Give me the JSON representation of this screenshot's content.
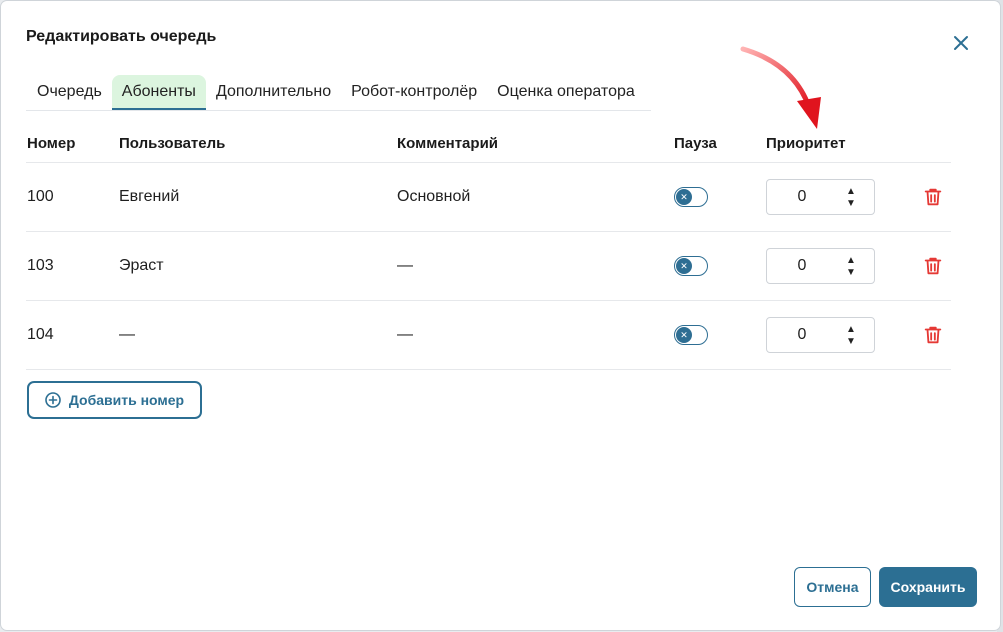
{
  "dialog": {
    "title": "Редактировать очередь",
    "close_icon": "close-icon"
  },
  "tabs": [
    {
      "label": "Очередь",
      "active": false
    },
    {
      "label": "Абоненты",
      "active": true
    },
    {
      "label": "Дополнительно",
      "active": false
    },
    {
      "label": "Робот-контролёр",
      "active": false
    },
    {
      "label": "Оценка оператора",
      "active": false
    }
  ],
  "table": {
    "headers": {
      "number": "Номер",
      "user": "Пользователь",
      "comment": "Комментарий",
      "pause": "Пауза",
      "priority": "Приоритет"
    },
    "rows": [
      {
        "number": "100",
        "user": "Евгений",
        "comment": "Основной",
        "pause": false,
        "priority": "0"
      },
      {
        "number": "103",
        "user": "Эраст",
        "comment": "—",
        "pause": false,
        "priority": "0"
      },
      {
        "number": "104",
        "user": "—",
        "comment": "—",
        "pause": false,
        "priority": "0"
      }
    ]
  },
  "actions": {
    "add_number": "Добавить номер",
    "cancel": "Отмена",
    "save": "Сохранить"
  },
  "colors": {
    "accent": "#2c6f93",
    "active_tab_bg": "#dcf5df",
    "delete": "#e53935",
    "annotation_arrow": "#e0141e"
  }
}
